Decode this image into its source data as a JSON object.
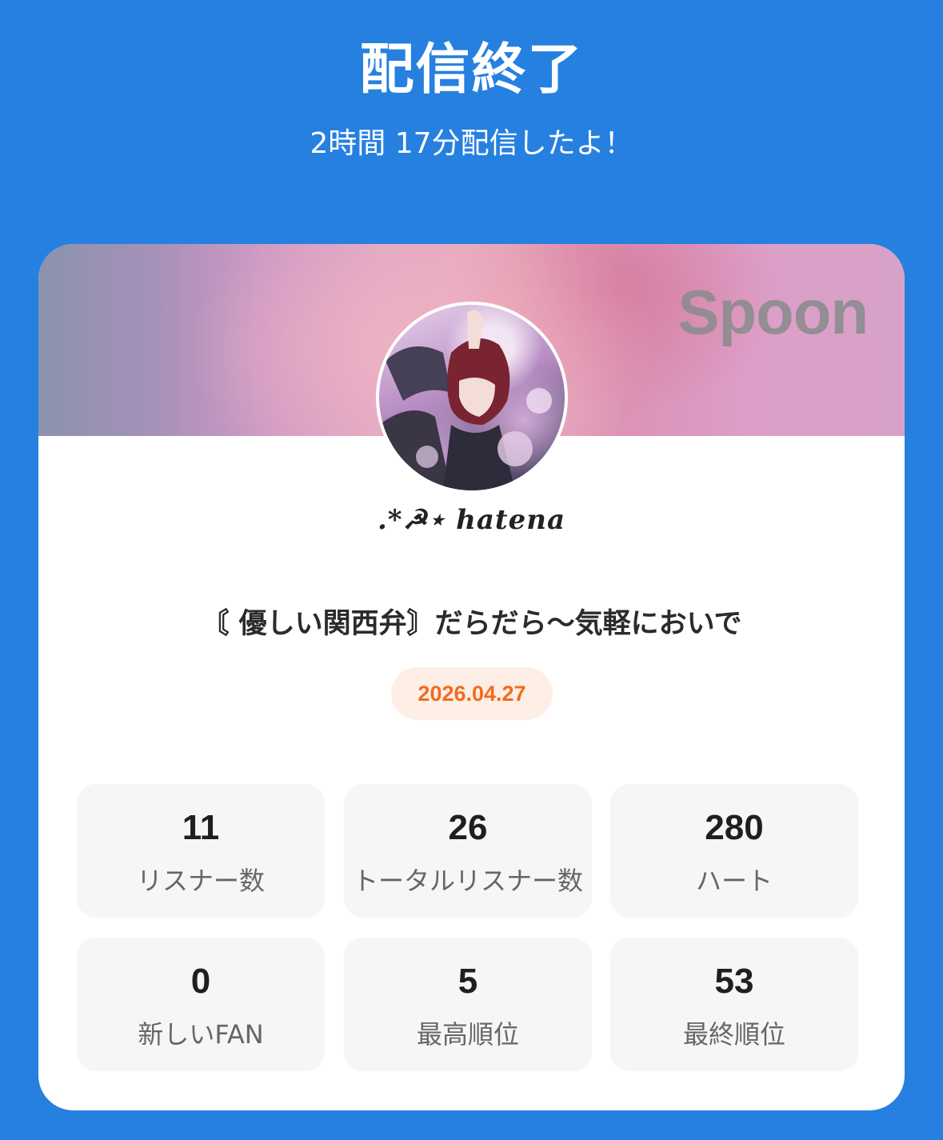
{
  "header": {
    "title": "配信終了",
    "subtitle": "2時間 17分配信したよ！"
  },
  "card": {
    "brand": "Spoon",
    "username": ".*☭⋆ hatena",
    "live_title": "〘 優しい関西弁〙だらだら～気軽においで",
    "date": "2026.04.27",
    "stats": [
      {
        "value": "11",
        "label": "リスナー数"
      },
      {
        "value": "26",
        "label": "トータルリスナー数"
      },
      {
        "value": "280",
        "label": "ハート"
      },
      {
        "value": "0",
        "label": "新しいFAN"
      },
      {
        "value": "5",
        "label": "最高順位"
      },
      {
        "value": "53",
        "label": "最終順位"
      }
    ]
  },
  "colors": {
    "background": "#2680e0",
    "card": "#ffffff",
    "date_text": "#f26b1d",
    "date_badge": "#fdeee6",
    "stat_tile": "#f6f6f6"
  }
}
